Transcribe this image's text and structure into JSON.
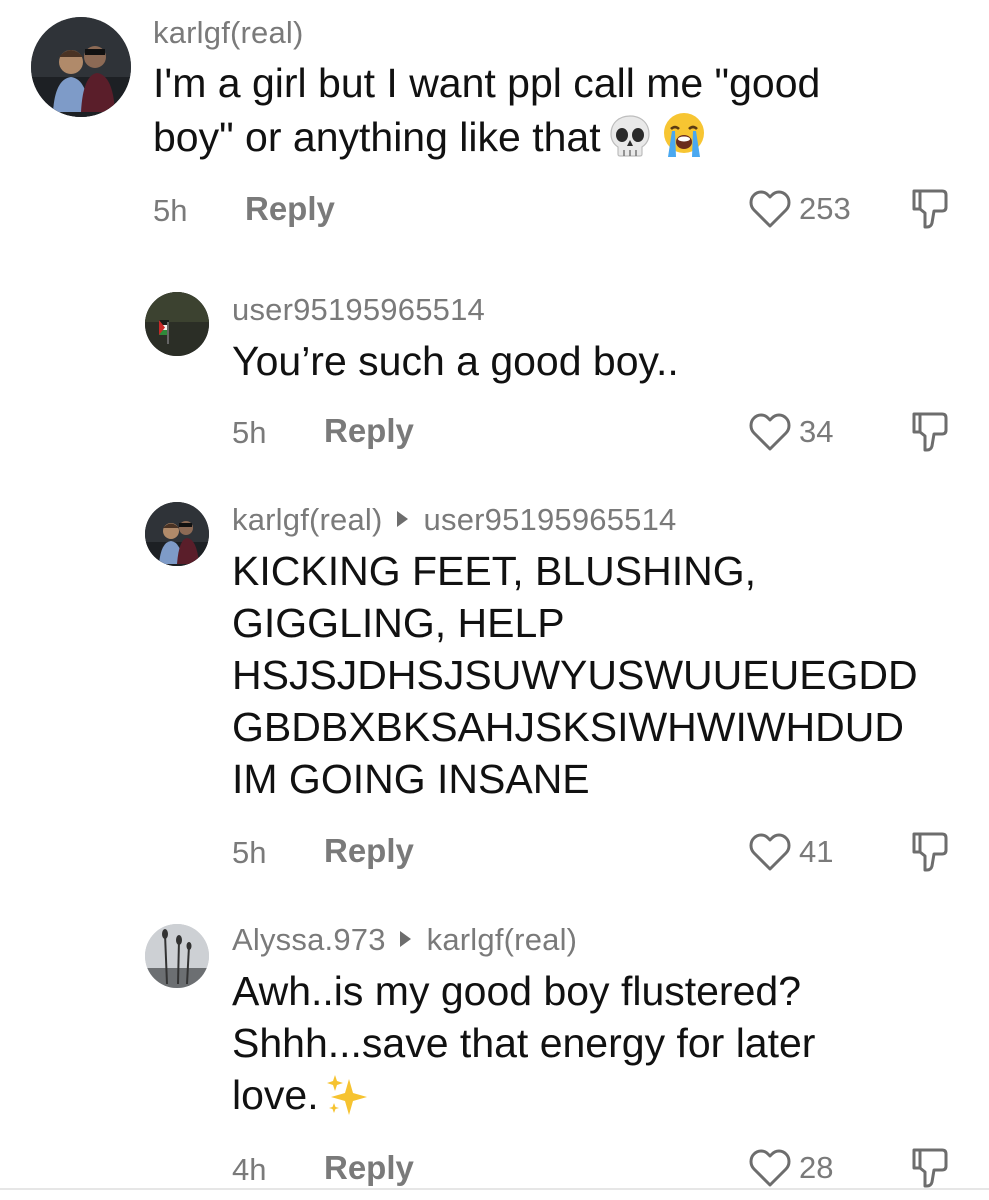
{
  "comments": [
    {
      "username": "karlgf(real)",
      "reply_to": "",
      "lines": [
        "I'm a girl but I want ppl call me \"good",
        "boy\" or anything like that"
      ],
      "emojis": [
        "skull-emoji",
        "loudly-crying-emoji"
      ],
      "time": "5h",
      "reply_label": "Reply",
      "likes": "253"
    },
    {
      "username": "user95195965514",
      "reply_to": "",
      "lines": [
        "You’re such a good boy.."
      ],
      "emojis": [],
      "time": "5h",
      "reply_label": "Reply",
      "likes": "34"
    },
    {
      "username": "karlgf(real)",
      "reply_to": "user95195965514",
      "lines": [
        "KICKING FEET, BLUSHING,",
        "GIGGLING, HELP",
        "HSJSJDHSJSUWYUSWUUEUEGDD",
        "GBDBXBKSAHJSKSIWHWIWHDUD",
        "IM GOING INSANE"
      ],
      "emojis": [],
      "time": "5h",
      "reply_label": "Reply",
      "likes": "41"
    },
    {
      "username": "Alyssa.973",
      "reply_to": "karlgf(real)",
      "lines": [
        "Awh..is my good boy flustered?",
        "Shhh...save that energy for later",
        "love."
      ],
      "emojis": [
        "sparkles-emoji"
      ],
      "time": "4h",
      "reply_label": "Reply",
      "likes": "28"
    }
  ],
  "icons": {
    "like": "heart-outline-icon",
    "dislike": "thumbs-down-icon"
  },
  "colors": {
    "text": "#111111",
    "secondary": "#7a7a7a",
    "background": "#ffffff"
  }
}
